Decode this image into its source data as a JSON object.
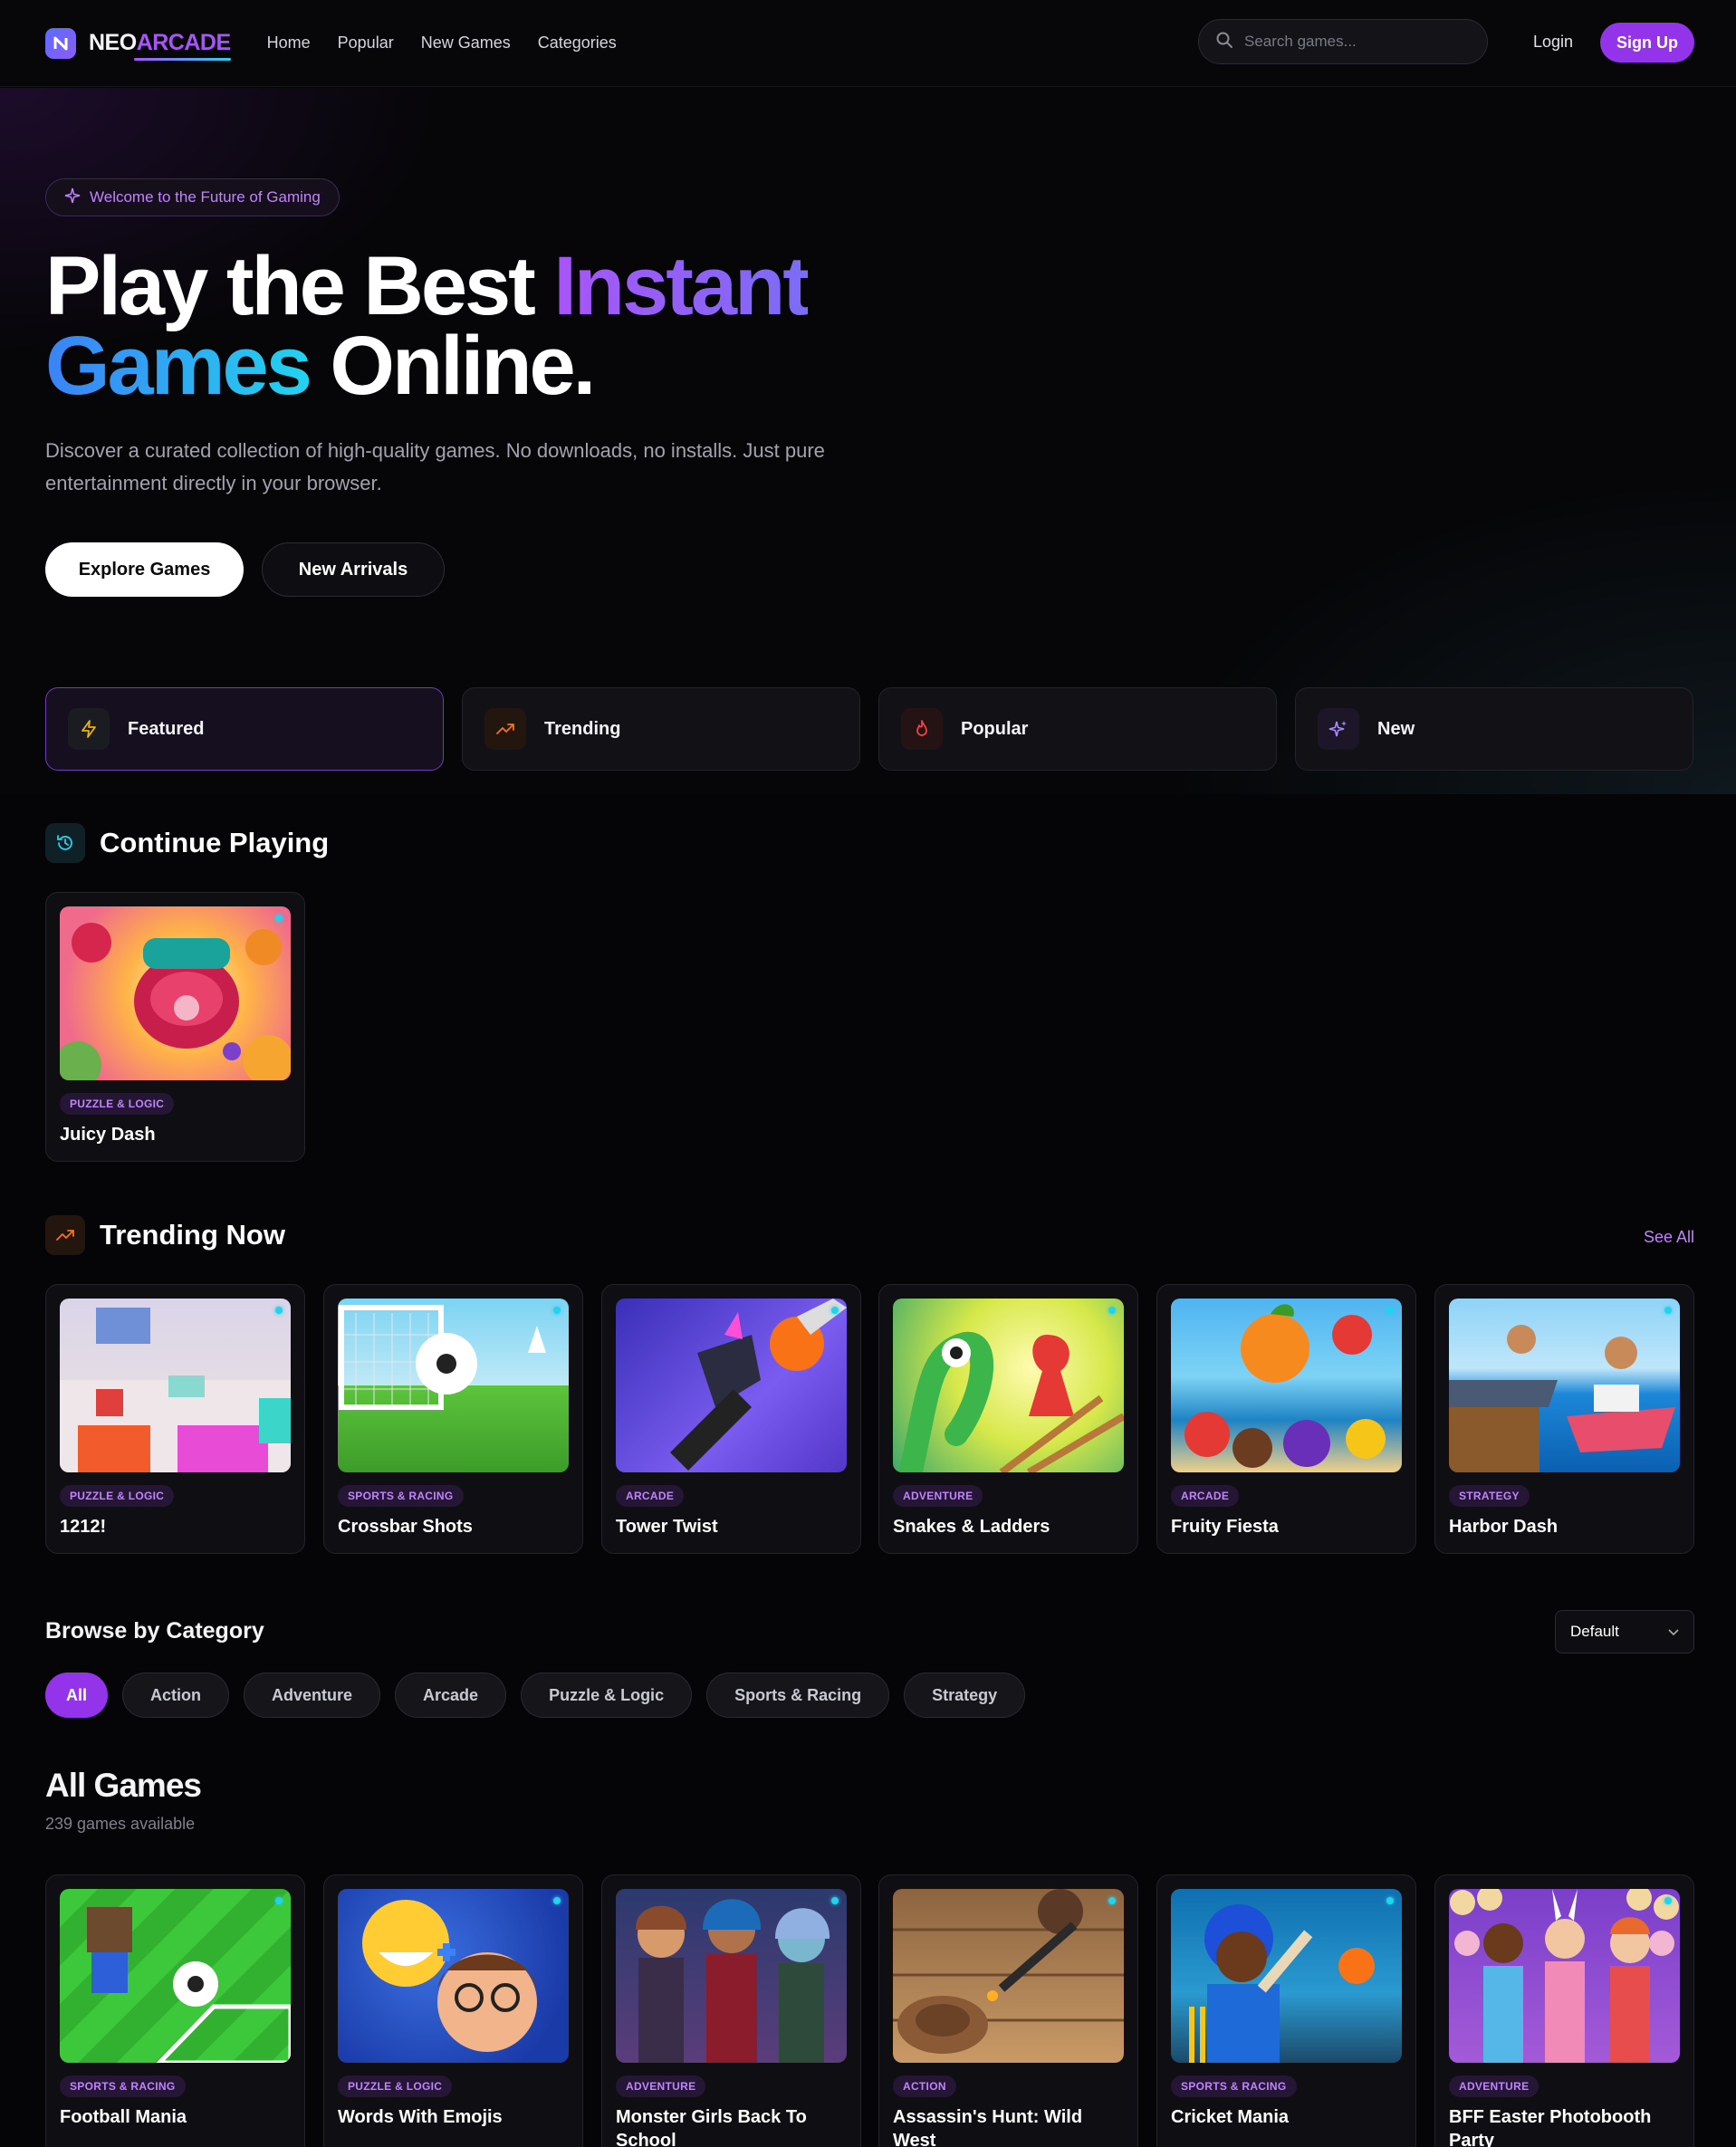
{
  "nav": {
    "logo_part1": "NEO",
    "logo_part2": "ARCADE",
    "links": [
      "Home",
      "Popular",
      "New Games",
      "Categories"
    ],
    "search_placeholder": "Search games...",
    "login": "Login",
    "signup": "Sign Up"
  },
  "hero": {
    "badge": "Welcome to the Future of Gaming",
    "title_line1_a": "Play the Best ",
    "title_line1_b": "Instant",
    "title_line2_a": "Games",
    "title_line2_b": " Online.",
    "subtitle": "Discover a curated collection of high-quality games. No downloads, no installs. Just pure entertainment directly in your browser.",
    "btn_explore": "Explore Games",
    "btn_new": "New Arrivals"
  },
  "quick_tabs": [
    {
      "label": "Featured",
      "icon": "lightning-icon"
    },
    {
      "label": "Trending",
      "icon": "trending-icon"
    },
    {
      "label": "Popular",
      "icon": "flame-icon"
    },
    {
      "label": "New",
      "icon": "sparkle-icon"
    }
  ],
  "continue": {
    "title": "Continue Playing",
    "games": [
      {
        "category": "PUZZLE & LOGIC",
        "name": "Juicy Dash"
      }
    ]
  },
  "trending": {
    "title": "Trending Now",
    "see_all": "See All",
    "games": [
      {
        "category": "PUZZLE & LOGIC",
        "name": "1212!"
      },
      {
        "category": "SPORTS & RACING",
        "name": "Crossbar Shots"
      },
      {
        "category": "ARCADE",
        "name": "Tower Twist"
      },
      {
        "category": "ADVENTURE",
        "name": "Snakes & Ladders"
      },
      {
        "category": "ARCADE",
        "name": "Fruity Fiesta"
      },
      {
        "category": "STRATEGY",
        "name": "Harbor Dash"
      }
    ]
  },
  "browse": {
    "title": "Browse by Category",
    "sort_value": "Default",
    "chips": [
      "All",
      "Action",
      "Adventure",
      "Arcade",
      "Puzzle & Logic",
      "Sports & Racing",
      "Strategy"
    ]
  },
  "all_games": {
    "title": "All Games",
    "count": "239 games available",
    "games": [
      {
        "category": "SPORTS & RACING",
        "name": "Football Mania"
      },
      {
        "category": "PUZZLE & LOGIC",
        "name": "Words With Emojis"
      },
      {
        "category": "ADVENTURE",
        "name": "Monster Girls Back To School"
      },
      {
        "category": "ACTION",
        "name": "Assassin's Hunt: Wild West"
      },
      {
        "category": "SPORTS & RACING",
        "name": "Cricket Mania"
      },
      {
        "category": "ADVENTURE",
        "name": "BFF Easter Photobooth Party"
      }
    ]
  },
  "colors": {
    "accent": "#9333ea",
    "accent_light": "#c084fc",
    "cyan": "#22d3ee",
    "background": "#050507"
  }
}
